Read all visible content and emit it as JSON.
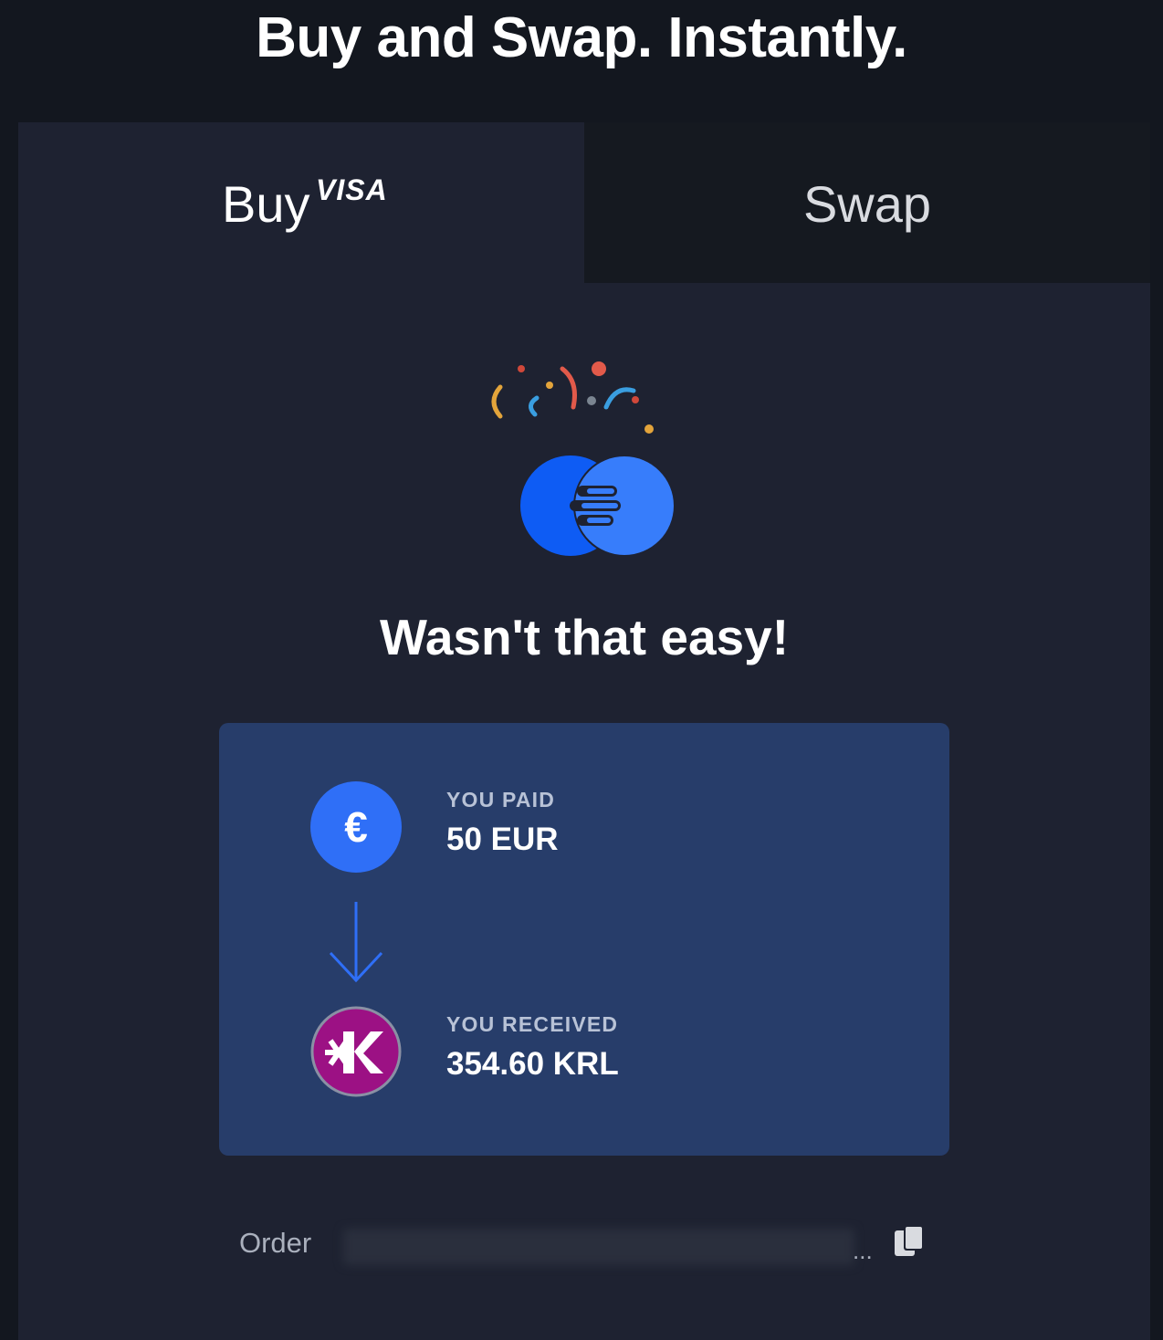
{
  "header": {
    "title": "Buy and Swap. Instantly."
  },
  "tabs": {
    "buy": {
      "label": "Buy",
      "badge": "VISA",
      "active": true
    },
    "swap": {
      "label": "Swap",
      "active": false
    }
  },
  "success": {
    "illustration": "celebration-confetti-coin-icon",
    "heading": "Wasn't that easy!"
  },
  "summary": {
    "paid": {
      "label": "YOU PAID",
      "value": "50 EUR",
      "icon": "euro-coin-icon",
      "icon_glyph": "€"
    },
    "received": {
      "label": "YOU RECEIVED",
      "value": "354.60 KRL",
      "icon": "kryll-coin-icon"
    },
    "arrow_icon": "arrow-down-icon"
  },
  "order": {
    "label": "Order",
    "id_ellipsis": "...",
    "copy_icon": "copy-icon"
  },
  "colors": {
    "page_background": "#13171f",
    "widget_background": "#1e2231",
    "inactive_tab": "#151920",
    "card_background": "#273d6a",
    "accent_blue": "#2f6ff7",
    "krl_purple": "#9c1184"
  }
}
